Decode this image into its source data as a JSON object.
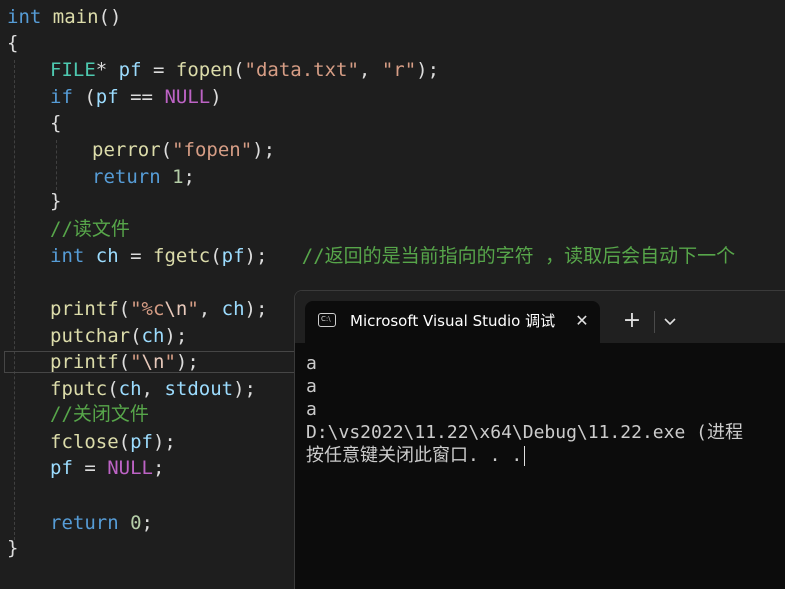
{
  "editor": {
    "lines": {
      "l1": {
        "kw": "int",
        "name": " main",
        "rest": "()"
      },
      "l2": {
        "brace": "{"
      },
      "l3": {
        "type": "FILE",
        "t1": "* ",
        "var": "pf",
        "t2": " = ",
        "fn": "fopen",
        "p1": "(",
        "s1": "\"data.txt\"",
        "p2": ", ",
        "s2": "\"r\"",
        "p3": ");"
      },
      "l4": {
        "kw": "if",
        "p1": " (",
        "var": "pf",
        "op": " == ",
        "mac": "NULL",
        "p2": ")"
      },
      "l5": {
        "brace": "{"
      },
      "l6": {
        "fn": "perror",
        "p1": "(",
        "s": "\"fopen\"",
        "p2": ");"
      },
      "l7": {
        "kw": "return",
        "sp": " ",
        "num": "1",
        "p": ";"
      },
      "l8": {
        "brace": "}"
      },
      "l9": {
        "cmt": "//读文件"
      },
      "l10": {
        "kw": "int",
        "sp": " ",
        "var": "ch",
        "op": " = ",
        "fn": "fgetc",
        "p1": "(",
        "var2": "pf",
        "p2": ");",
        "gap": "   ",
        "cmt": "//返回的是当前指向的字符 ，读取后会自动下一个"
      },
      "l11": {
        "fn": "printf",
        "p1": "(",
        "s1": "\"%c",
        "esc": "\\n",
        "s2": "\"",
        "p2": ", ",
        "var": "ch",
        "p3": ");"
      },
      "l12": {
        "fn": "putchar",
        "p1": "(",
        "var": "ch",
        "p2": ");"
      },
      "l13": {
        "fn": "printf",
        "p1": "(",
        "s1": "\"",
        "esc": "\\n",
        "s2": "\"",
        "p2": ");"
      },
      "l14": {
        "fn": "fputc",
        "p1": "(",
        "var": "ch",
        "p2": ", ",
        "var2": "stdout",
        "p3": ");"
      },
      "l15": {
        "cmt": "//关闭文件"
      },
      "l16": {
        "fn": "fclose",
        "p1": "(",
        "var": "pf",
        "p2": ");"
      },
      "l17": {
        "var": "pf",
        "op": " = ",
        "mac": "NULL",
        "p": ";"
      },
      "l18": {
        "kw": "return",
        "sp": " ",
        "num": "0",
        "p": ";"
      },
      "l19": {
        "brace": "}"
      }
    }
  },
  "terminal": {
    "tab_icon_text": "C:\\",
    "tab_title": "Microsoft Visual Studio 调试控制台",
    "close_glyph": "✕",
    "new_tab_glyph": "+",
    "output": [
      "a",
      "a",
      "a",
      "D:\\vs2022\\11.22\\x64\\Debug\\11.22.exe (进程",
      "按任意键关闭此窗口. . ."
    ]
  },
  "colors": {
    "background": "#1e1e1e",
    "keyword": "#569cd6",
    "type": "#4ec9b0",
    "function": "#dcdcaa",
    "variable": "#9cdcfe",
    "macro": "#bd63c5",
    "string": "#d69d85",
    "comment": "#57a64a",
    "number": "#b5cea8",
    "terminal_bg": "#0c0c0c"
  }
}
